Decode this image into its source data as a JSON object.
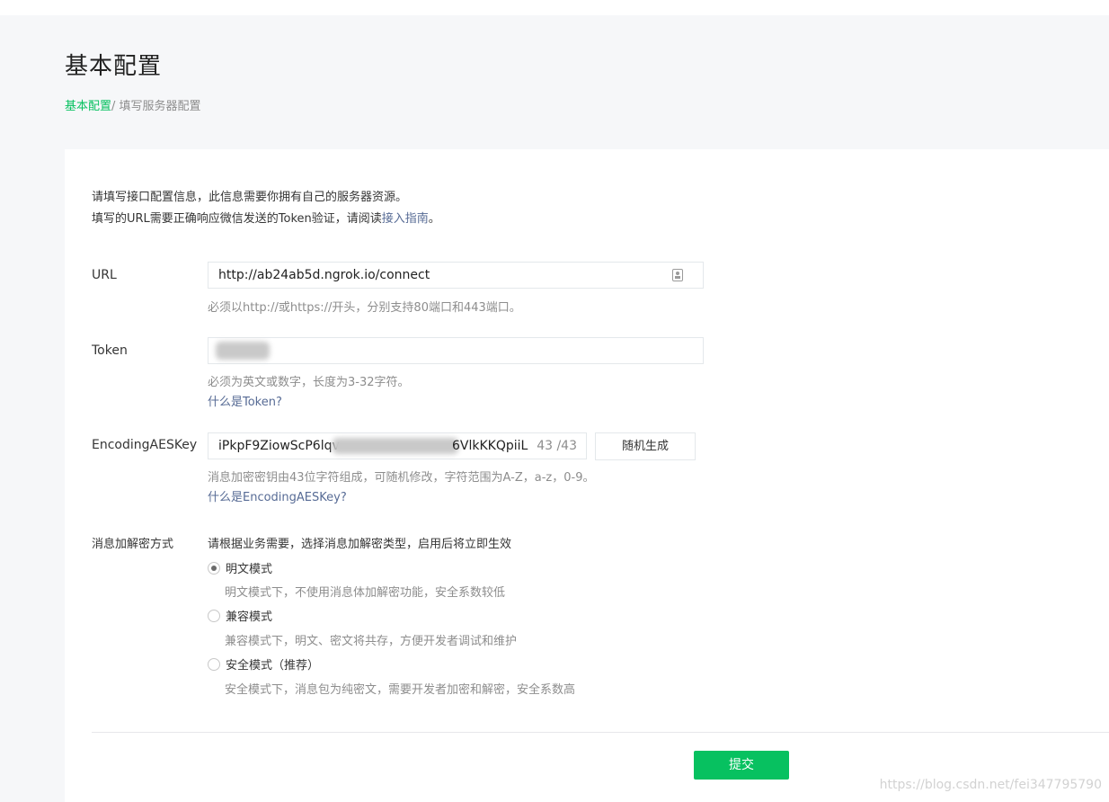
{
  "page": {
    "title": "基本配置",
    "breadcrumb_link": "基本配置",
    "breadcrumb_separator": "/ ",
    "breadcrumb_current": "填写服务器配置"
  },
  "intro": {
    "line1": "请填写接口配置信息，此信息需要你拥有自己的服务器资源。",
    "line2_prefix": "填写的URL需要正确响应微信发送的Token验证，请阅读",
    "line2_link": "接入指南",
    "line2_suffix": "。"
  },
  "fields": {
    "url": {
      "label": "URL",
      "value": "http://ab24ab5d.ngrok.io/connect",
      "hint": "必须以http://或https://开头，分别支持80端口和443端口。",
      "icon": "contact-card-icon"
    },
    "token": {
      "label": "Token",
      "value": "",
      "hint": "必须为英文或数字，长度为3-32字符。",
      "help_link": "什么是Token?"
    },
    "aes": {
      "label": "EncodingAESKey",
      "value_start": "iPkpF9ZiowScP6lqv",
      "value_end": "6VlkKKQpiiL",
      "counter": "43 /43",
      "random_button": "随机生成",
      "hint": "消息加密密钥由43位字符组成，可随机修改，字符范围为A-Z，a-z，0-9。",
      "help_link": "什么是EncodingAESKey?"
    }
  },
  "encryption": {
    "label": "消息加解密方式",
    "desc": "请根据业务需要，选择消息加解密类型，启用后将立即生效",
    "options": [
      {
        "label": "明文模式",
        "desc": "明文模式下，不使用消息体加解密功能，安全系数较低",
        "checked": true
      },
      {
        "label": "兼容模式",
        "desc": "兼容模式下，明文、密文将共存，方便开发者调试和维护",
        "checked": false
      },
      {
        "label": "安全模式（推荐）",
        "desc": "安全模式下，消息包为纯密文，需要开发者加密和解密，安全系数高",
        "checked": false
      }
    ]
  },
  "submit_label": "提交",
  "watermark": "https://blog.csdn.net/fei347795790",
  "colors": {
    "accent": "#07c160",
    "link": "#576b95",
    "hint": "#8d8d8d",
    "background": "#f6f7f9"
  }
}
